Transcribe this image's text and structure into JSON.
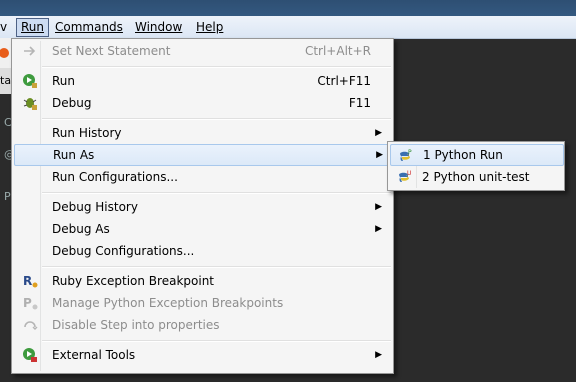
{
  "menubar": {
    "items": [
      {
        "label": "v"
      },
      {
        "label": "Run"
      },
      {
        "label": "Commands"
      },
      {
        "label": "Window"
      },
      {
        "label": "Help"
      }
    ]
  },
  "toolbar_fragment": "tar",
  "run_menu": {
    "items": [
      {
        "label": "Set Next Statement",
        "accel": "Ctrl+Alt+R"
      },
      {
        "label": "Run",
        "accel": "Ctrl+F11"
      },
      {
        "label": "Debug",
        "accel": "F11"
      },
      {
        "label": "Run History"
      },
      {
        "label": "Run As"
      },
      {
        "label": "Run Configurations..."
      },
      {
        "label": "Debug History"
      },
      {
        "label": "Debug As"
      },
      {
        "label": "Debug Configurations..."
      },
      {
        "label": "Ruby Exception Breakpoint"
      },
      {
        "label": "Manage Python Exception Breakpoints"
      },
      {
        "label": "Disable Step into properties"
      },
      {
        "label": "External Tools"
      }
    ]
  },
  "run_as_submenu": {
    "items": [
      {
        "label": "1 Python Run"
      },
      {
        "label": "2 Python unit-test"
      }
    ]
  },
  "colors": {
    "menu_bg": "#f5f5f5",
    "hover_bg": "#dce9f8",
    "hover_border": "#a8c8ec",
    "disabled_text": "#8d8d8d"
  }
}
